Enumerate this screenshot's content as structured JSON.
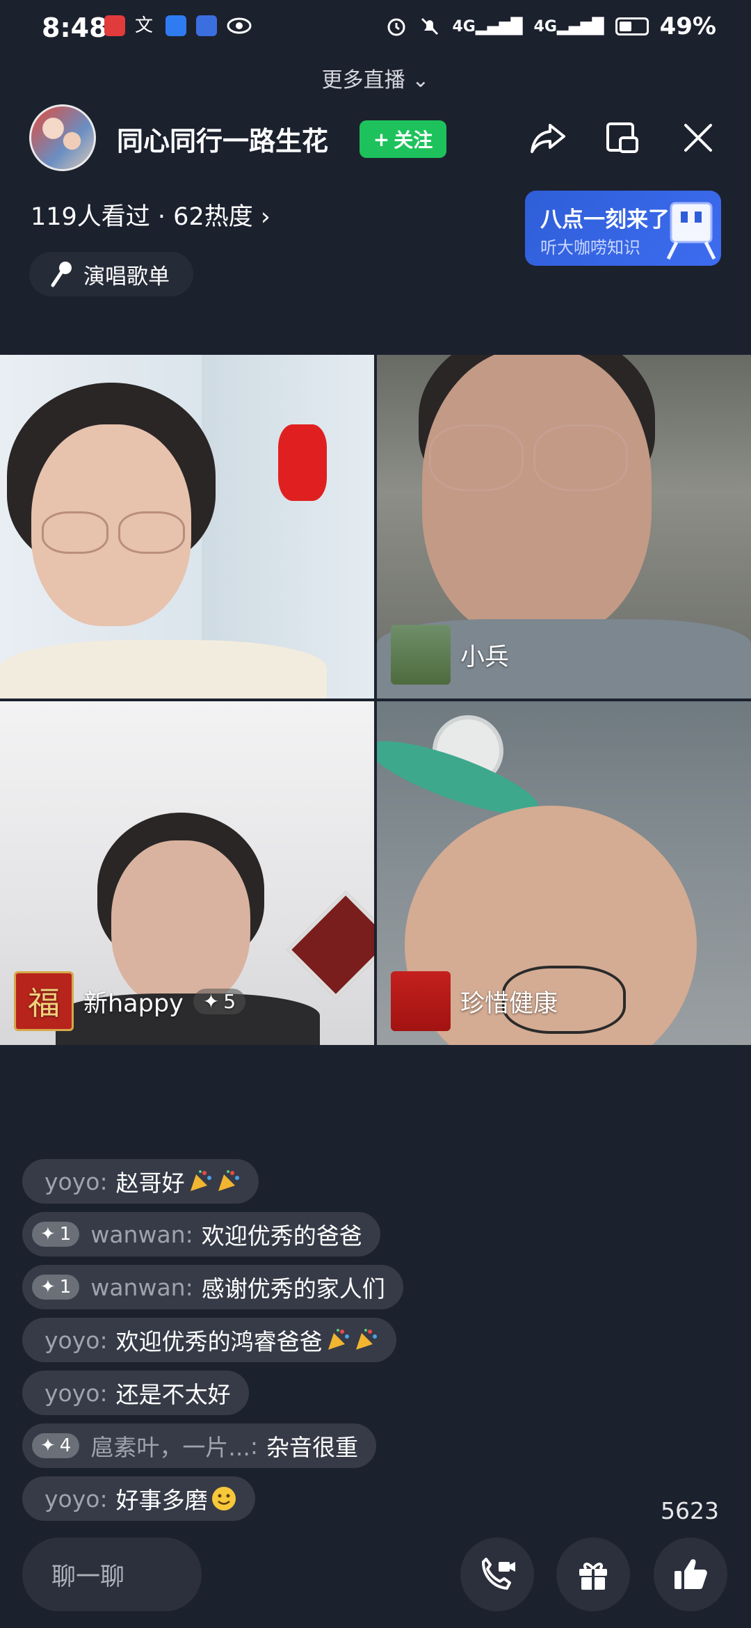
{
  "status_bar": {
    "time": "8:48",
    "signal1": "4G",
    "signal2": "4G",
    "battery": "49%",
    "battery_level": 0.49
  },
  "header": {
    "more_live_label": "更多直播",
    "room_title": "同心同行一路生花",
    "follow_label": "关注",
    "stats": "119人看过 · 62热度",
    "songs_label": "演唱歌单"
  },
  "promo": {
    "title": "八点一刻来了",
    "subtitle": "听大咖唠知识"
  },
  "participants": [
    {
      "name": ""
    },
    {
      "name": "小兵"
    },
    {
      "name": "新happy",
      "plus": "5"
    },
    {
      "name": "珍惜健康"
    }
  ],
  "chat": [
    {
      "user": "yoyo",
      "text": "赵哥好",
      "emoji": "party"
    },
    {
      "badge": "1",
      "user": "wanwan",
      "text": "欢迎优秀的爸爸"
    },
    {
      "badge": "1",
      "user": "wanwan",
      "text": "感谢优秀的家人们"
    },
    {
      "user": "yoyo",
      "text": "欢迎优秀的鸿睿爸爸",
      "emoji": "party"
    },
    {
      "user": "yoyo",
      "text": "还是不太好"
    },
    {
      "badge": "4",
      "user": "扈素叶，一片...",
      "text": "杂音很重"
    },
    {
      "user": "yoyo",
      "text": "好事多磨",
      "emoji": "smile"
    }
  ],
  "footer": {
    "like_count": "5623",
    "chat_placeholder": "聊一聊"
  },
  "colors": {
    "background": "#1c212e",
    "follow_green": "#1ec25c",
    "promo_blue": "#3d6cf0"
  },
  "icons": [
    "share-icon",
    "float-window-icon",
    "close-icon",
    "microphone-icon",
    "video-call-icon",
    "gift-icon",
    "thumbs-up-icon"
  ]
}
